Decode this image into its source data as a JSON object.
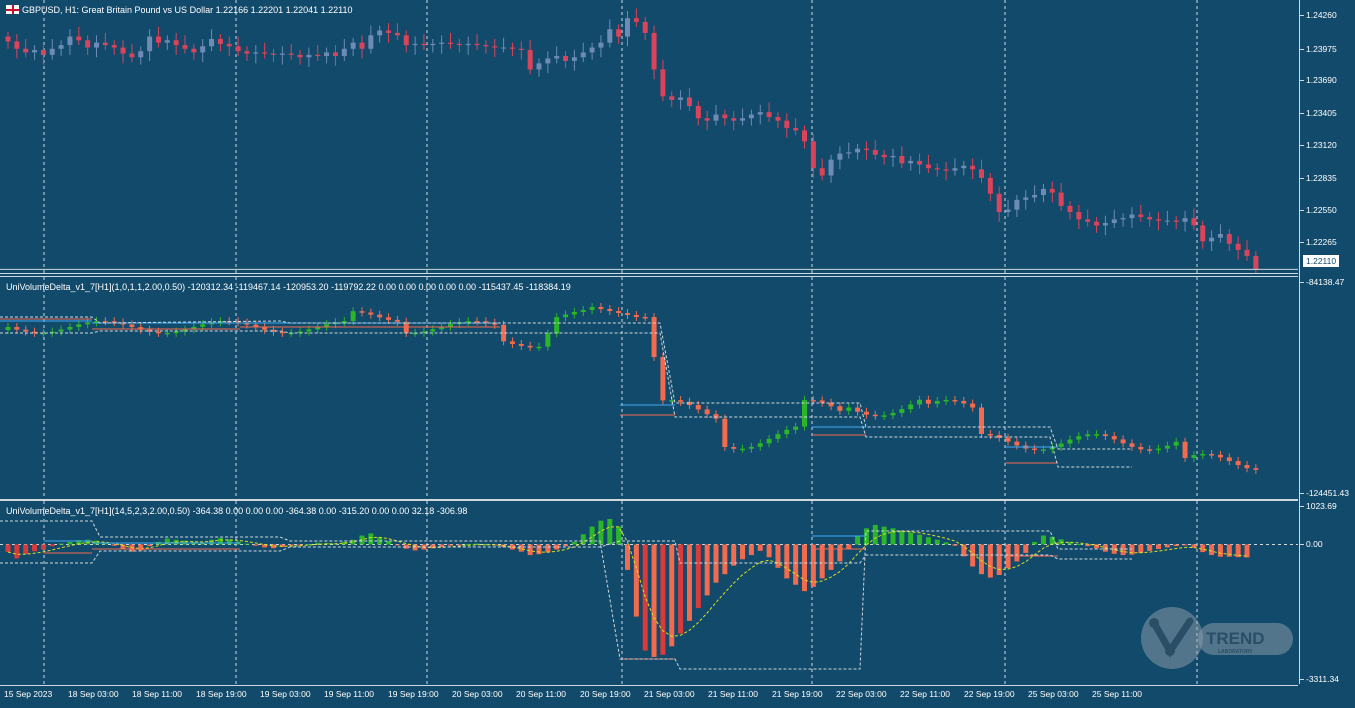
{
  "chart_title": "GBPUSD, H1:  Great Britain Pound vs US Dollar  1.22166 1.22201 1.22041 1.22110",
  "indicator1_legend": "UniVolumeDelta_v1_7[H1](1,0,1,1,2.00,0.50) -120312.34 -119467.14 -120953.20 -119792.22 0.00 0.00 0.00 0.00 0.00 -115437.45 -118384.19",
  "indicator2_legend": "UniVolumeDelta_v1_7[H1](14,5,2,3,2.00,0.50) -364.38 0.00 0.00 0.00 -364.38 0.00 -315.20 0.00 0.00 32.18 -306.98",
  "current_price": "1.22110",
  "price_axis": [
    "1.24260",
    "1.23975",
    "1.23690",
    "1.23405",
    "1.23120",
    "1.22835",
    "1.22550",
    "1.22265"
  ],
  "indicator1_axis": [
    "-84138.47",
    "-124451.43"
  ],
  "indicator2_axis": [
    "1023.69",
    "0.00",
    "-3311.34"
  ],
  "time_axis": [
    "15 Sep 2023",
    "18 Sep 03:00",
    "18 Sep 11:00",
    "18 Sep 19:00",
    "19 Sep 03:00",
    "19 Sep 11:00",
    "19 Sep 19:00",
    "20 Sep 03:00",
    "20 Sep 11:00",
    "20 Sep 19:00",
    "21 Sep 03:00",
    "21 Sep 11:00",
    "21 Sep 19:00",
    "22 Sep 03:00",
    "22 Sep 11:00",
    "22 Sep 19:00",
    "25 Sep 03:00",
    "25 Sep 11:00"
  ],
  "logo_text": "TREND",
  "logo_subtext": "LABORATORY",
  "colors": {
    "background": "#124a6b",
    "bull_candle": "#6d8bb5",
    "bear_candle": "#d9445a",
    "delta_up": "#2bb52b",
    "delta_down": "#f26b4f",
    "delta_down_dark": "#d93b3b",
    "signal_line": "#d9e021",
    "level_blue": "#3fa9f5",
    "level_red": "#f26b4f"
  },
  "chart_data": [
    {
      "type": "candlestick",
      "title": "GBPUSD, H1:  Great Britain Pound vs US Dollar",
      "ylim": [
        1.2208,
        1.2432
      ],
      "close": [
        1.2398,
        1.2392,
        1.2389,
        1.2391,
        1.2387,
        1.2392,
        1.2395,
        1.2402,
        1.2399,
        1.2393,
        1.2397,
        1.2395,
        1.2393,
        1.2388,
        1.2385,
        1.239,
        1.2402,
        1.2397,
        1.2399,
        1.2395,
        1.2392,
        1.2389,
        1.2394,
        1.24,
        1.2396,
        1.2394,
        1.239,
        1.2388,
        1.2389,
        1.2388,
        1.2387,
        1.2388,
        1.2387,
        1.2385,
        1.2387,
        1.2386,
        1.2389,
        1.2386,
        1.2392,
        1.2397,
        1.2392,
        1.2403,
        1.2407,
        1.2405,
        1.2403,
        1.2395,
        1.2396,
        1.2395,
        1.2396,
        1.2397,
        1.2396,
        1.2395,
        1.2396,
        1.2395,
        1.2394,
        1.2393,
        1.2393,
        1.2392,
        1.2391,
        1.2375,
        1.238,
        1.2384,
        1.2386,
        1.2382,
        1.2385,
        1.2389,
        1.2393,
        1.2397,
        1.2408,
        1.2402,
        1.2417,
        1.2414,
        1.2405,
        1.2375,
        1.2353,
        1.235,
        1.2352,
        1.2345,
        1.2335,
        1.2333,
        1.2338,
        1.2335,
        1.2333,
        1.2335,
        1.2338,
        1.234,
        1.2336,
        1.2333,
        1.2327,
        1.2325,
        1.2316,
        1.2294,
        1.2288,
        1.2301,
        1.2306,
        1.2307,
        1.231,
        1.2309,
        1.2305,
        1.2303,
        1.2304,
        1.2298,
        1.23,
        1.2297,
        1.2294,
        1.2293,
        1.2292,
        1.2294,
        1.2296,
        1.2293,
        1.2286,
        1.2273,
        1.2258,
        1.226,
        1.2268,
        1.227,
        1.2272,
        1.2277,
        1.2274,
        1.2263,
        1.2258,
        1.2252,
        1.225,
        1.2247,
        1.2249,
        1.2252,
        1.2253,
        1.2256,
        1.2254,
        1.2252,
        1.2251,
        1.2251,
        1.225,
        1.2253,
        1.2247,
        1.2234,
        1.2237,
        1.224,
        1.2232,
        1.2227,
        1.2222,
        1.2211
      ]
    },
    {
      "type": "candlestick",
      "title": "UniVolumeDelta_v1_7[H1](1,0,1,1,2.00,0.50)",
      "ylim": [
        -124451.43,
        -84138.47
      ]
    },
    {
      "type": "bar",
      "title": "UniVolumeDelta_v1_7[H1](14,5,2,3,2.00,0.50)",
      "ylim": [
        -3311.34,
        1023.69
      ],
      "values": [
        -180,
        -330,
        -230,
        -160,
        -120,
        -40,
        20,
        60,
        100,
        110,
        90,
        40,
        -30,
        -120,
        -170,
        -140,
        -40,
        60,
        140,
        110,
        90,
        60,
        40,
        110,
        150,
        120,
        70,
        20,
        -30,
        -70,
        -90,
        -60,
        -30,
        -10,
        10,
        40,
        30,
        20,
        60,
        110,
        210,
        260,
        170,
        80,
        -20,
        -100,
        -140,
        -120,
        -90,
        -60,
        -30,
        -10,
        10,
        20,
        0,
        -20,
        -60,
        -120,
        -170,
        -250,
        -230,
        -190,
        -120,
        -40,
        60,
        240,
        420,
        560,
        600,
        420,
        -600,
        -1700,
        -2500,
        -2650,
        -2600,
        -2400,
        -2100,
        -1800,
        -1500,
        -1200,
        -900,
        -700,
        -500,
        -350,
        -250,
        -150,
        -300,
        -550,
        -800,
        -950,
        -1100,
        -1000,
        -800,
        -600,
        -400,
        -100,
        200,
        380,
        460,
        420,
        380,
        330,
        280,
        230,
        170,
        110,
        50,
        -30,
        -280,
        -520,
        -700,
        -780,
        -720,
        -560,
        -400,
        -200,
        60,
        210,
        180,
        120,
        60,
        10,
        -40,
        -90,
        -170,
        -220,
        -250,
        -240,
        -200,
        -150,
        -110,
        -70,
        -40,
        -20,
        -80,
        -180,
        -250,
        -290,
        -290,
        -300,
        -307
      ]
    }
  ]
}
